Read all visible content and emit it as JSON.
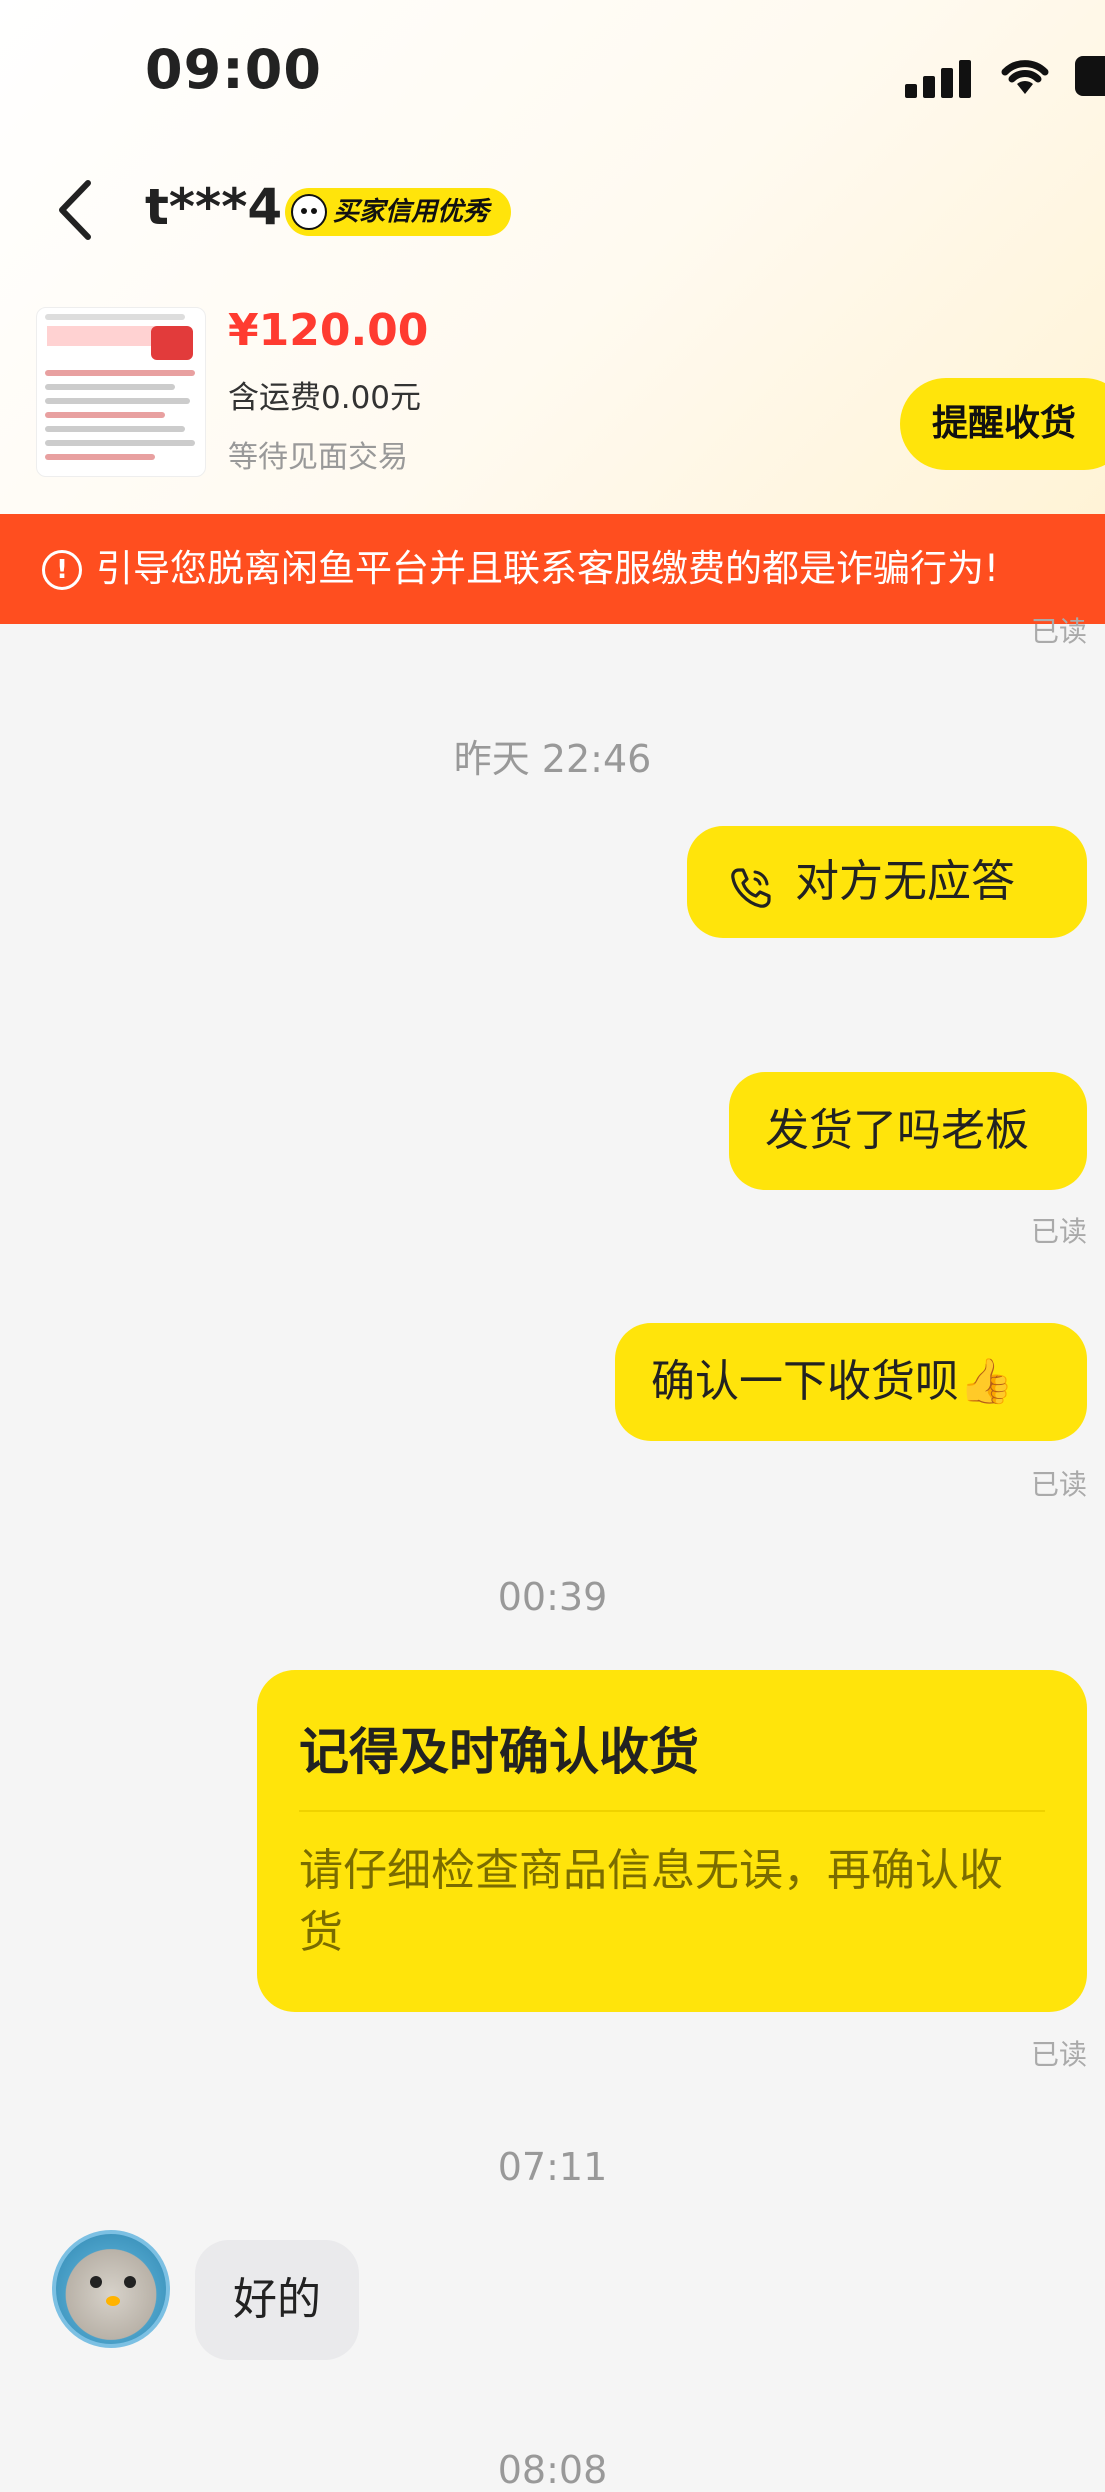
{
  "status_bar": {
    "time": "09:00"
  },
  "header": {
    "nickname": "t***4",
    "credit_badge": "买家信用优秀"
  },
  "product": {
    "price": "¥120.00",
    "shipping": "含运费0.00元",
    "status": "等待见面交易",
    "remind_button": "提醒收货"
  },
  "warning_banner": {
    "text": "引导您脱离闲鱼平台并且联系客服缴费的都是诈骗行为!"
  },
  "chat": {
    "read_label": "已读",
    "time_yesterday": "昨天 22:46",
    "msg_call": "对方无应答",
    "msg_shipped": "发货了吗老板",
    "msg_confirm": "确认一下收货呗👍",
    "time_0039": "00:39",
    "card_title": "记得及时确认收货",
    "card_body": "请仔细检查商品信息无误，再确认收货",
    "time_0711": "07:11",
    "msg_reply": "好的",
    "time_bottom_partial": "08:08"
  },
  "icons": [
    "back-icon",
    "phone-call-icon",
    "warning-icon",
    "signal-icon",
    "wifi-icon",
    "battery-icon"
  ],
  "colors": {
    "accent_yellow": "#ffe40b",
    "warning_orange": "#ff4e1f",
    "price_red": "#ff3b30"
  }
}
